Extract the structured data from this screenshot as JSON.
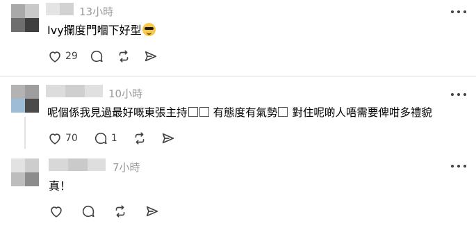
{
  "posts": [
    {
      "timestamp": "13小時",
      "text": "Ivy攔度門嗰下好型",
      "emoji": "smiling-face-with-sunglasses",
      "likes": "29"
    },
    {
      "timestamp": "10小時",
      "text_a": "呢個係我見過最好嘅東張主持",
      "text_b": " 有態度有氣勢",
      "text_c": " 對住呢啲人唔需要俾咁多禮貌",
      "likes": "70",
      "replies": "1"
    },
    {
      "timestamp": "7小時",
      "text": "真！"
    }
  ],
  "colors": {
    "timestamp": "#999999",
    "icon": "#424242",
    "divider": "#dcdcdc"
  },
  "icons": [
    "heart-icon",
    "comment-icon",
    "repost-icon",
    "share-icon",
    "more-icon"
  ]
}
